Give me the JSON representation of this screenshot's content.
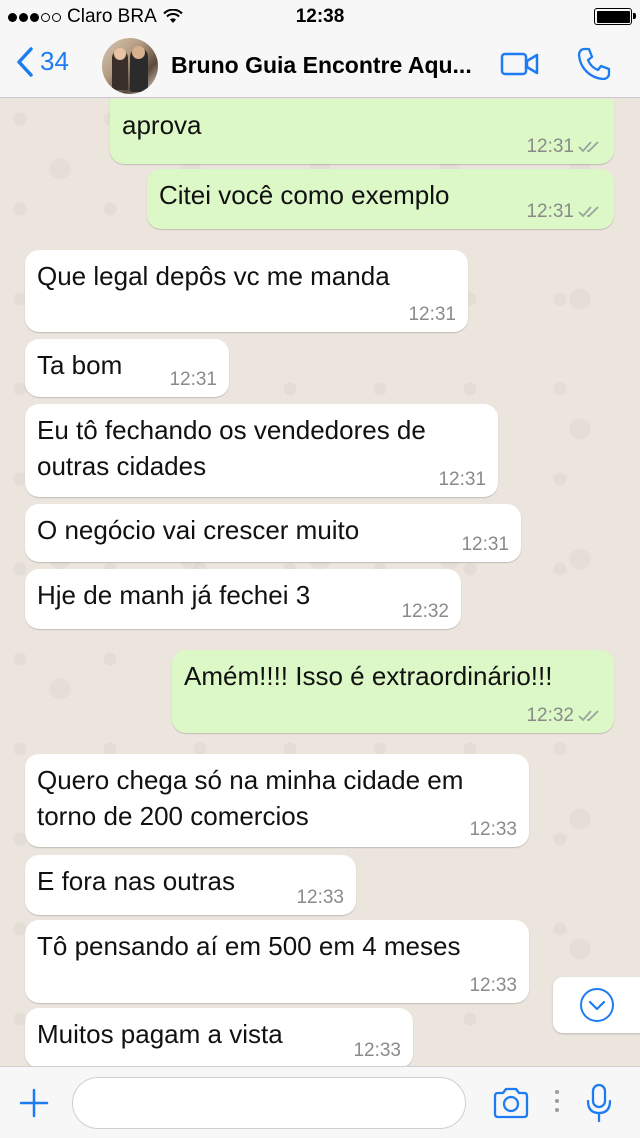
{
  "status_bar": {
    "carrier": "Claro BRA",
    "time": "12:38"
  },
  "header": {
    "back_count": "34",
    "contact_name": "Bruno Guia Encontre Aqu...",
    "accent_color": "#1e7cf2"
  },
  "messages": [
    {
      "dir": "out",
      "text": "aprova",
      "time": "12:31",
      "ticks": "read"
    },
    {
      "dir": "out",
      "text": "Citei você como exemplo",
      "time": "12:31",
      "ticks": "read"
    },
    {
      "dir": "in",
      "text": "Que legal depôs vc me manda",
      "time": "12:31"
    },
    {
      "dir": "in",
      "text": "Ta bom",
      "time": "12:31"
    },
    {
      "dir": "in",
      "text": "Eu tô fechando os vendedores de\noutras cidades",
      "time": "12:31"
    },
    {
      "dir": "in",
      "text": "O negócio vai crescer muito",
      "time": "12:31"
    },
    {
      "dir": "in",
      "text": "Hje de manh já fechei 3",
      "time": "12:32"
    },
    {
      "dir": "out",
      "text": "Amém!!!! Isso é extraordinário!!!",
      "time": "12:32",
      "ticks": "read"
    },
    {
      "dir": "in",
      "text": "Quero chega só na minha cidade em\ntorno de 200 comercios",
      "time": "12:33"
    },
    {
      "dir": "in",
      "text": "E fora nas outras",
      "time": "12:33"
    },
    {
      "dir": "in",
      "text": "Tô pensando aí em 500 em 4 meses",
      "time": "12:33"
    },
    {
      "dir": "in",
      "text": "Muitos pagam a vista",
      "time": "12:33"
    }
  ],
  "input": {
    "value": "",
    "placeholder": ""
  },
  "colors": {
    "incoming_bubble": "#ffffff",
    "outgoing_bubble": "#dcf8c6",
    "chat_background": "#ece5dd"
  }
}
